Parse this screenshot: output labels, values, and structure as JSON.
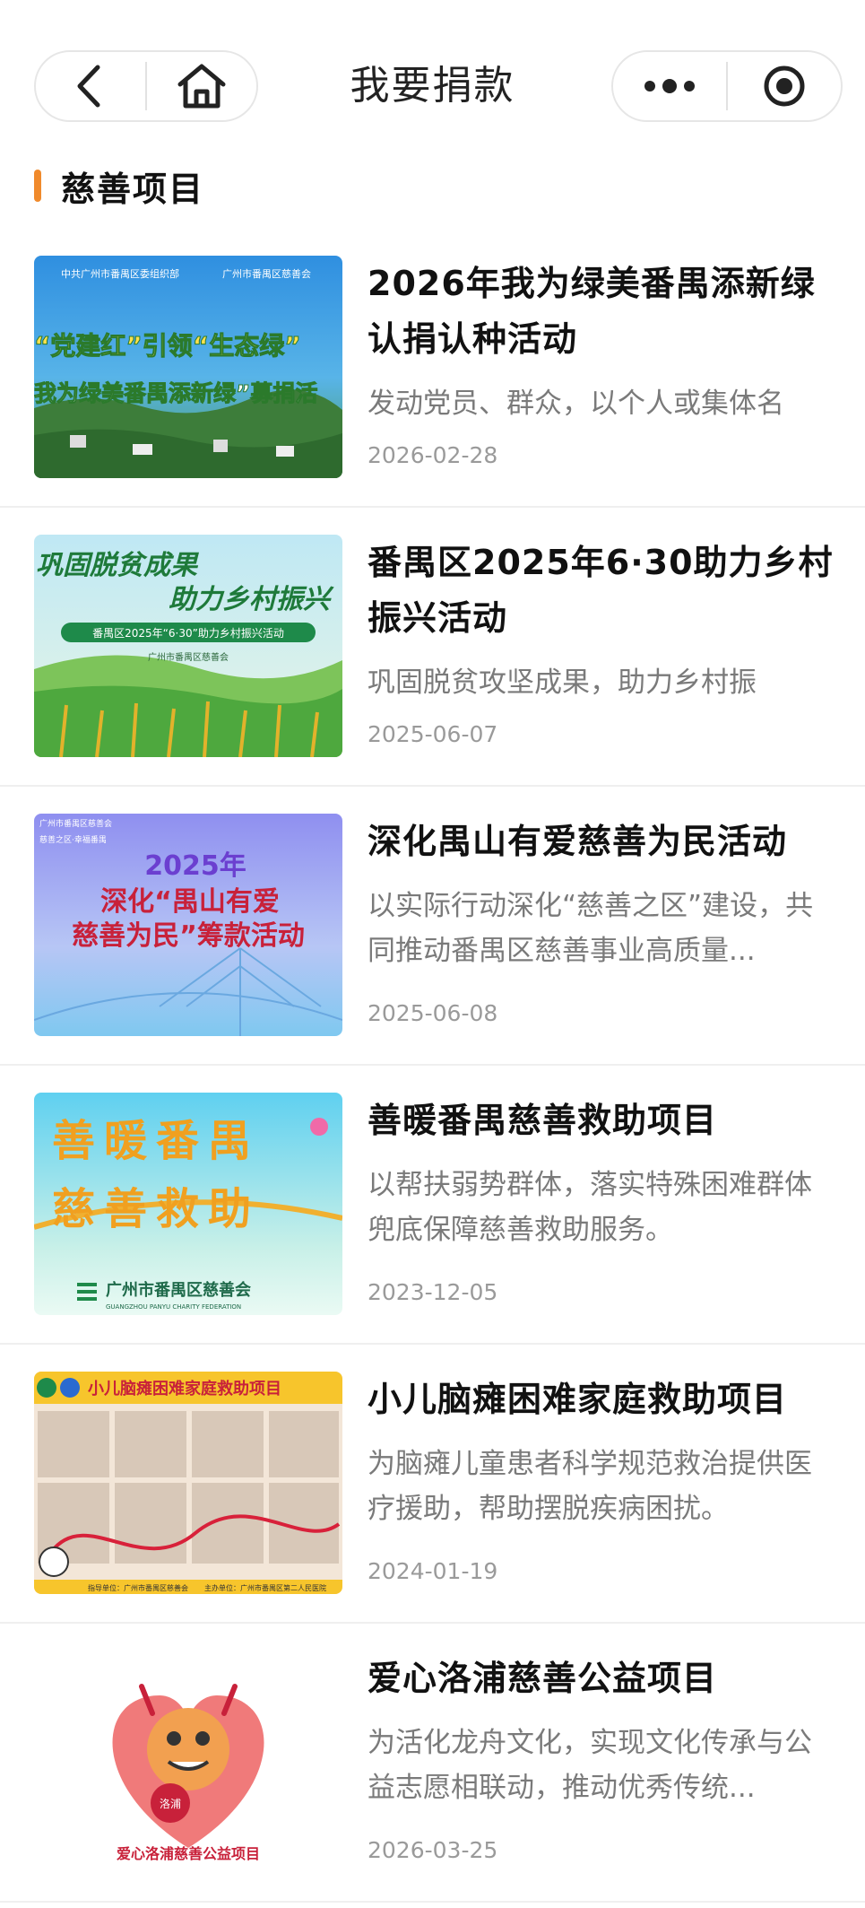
{
  "header": {
    "title": "我要捐款",
    "back_icon": "chevron-left-icon",
    "home_icon": "home-icon",
    "more_icon": "more-dots-icon",
    "record_icon": "target-circle-icon"
  },
  "section": {
    "title": "慈善项目",
    "accent_color": "#f08a2c"
  },
  "items": [
    {
      "title": "2026年我为绿美番禺添新绿认捐认种活动",
      "desc": "发动党员、群众，以个人或集体名",
      "date": "2026-02-28",
      "thumb": {
        "l1": "中共广州市番禺区委组织部",
        "l2": "广州市番禺区慈善会",
        "l3": "“党建红”引领“生态绿”",
        "l4": "我为绿美番禺添新绿”募捐活"
      }
    },
    {
      "title": "番禺区2025年6·30助力乡村振兴活动",
      "desc": "巩固脱贫攻坚成果，助力乡村振",
      "date": "2025-06-07",
      "thumb": {
        "l1": "巩固脱贫成果",
        "l2": "助力乡村振兴",
        "l3": "番禺区2025年“6·30”助力乡村振兴活动",
        "l4": "广州市番禺区慈善会"
      }
    },
    {
      "title": "深化禺山有爱慈善为民活动",
      "desc": "以实际行动深化“慈善之区”建设，共同推动番禺区慈善事业高质量...",
      "date": "2025-06-08",
      "thumb": {
        "l1": "广州市番禺区慈善会",
        "l2": "慈善之区·幸福番禺",
        "l3": "2025年",
        "l4": "深化“禺山有爱",
        "l5": "慈善为民”筹款活动"
      }
    },
    {
      "title": "善暖番禺慈善救助项目",
      "desc": "以帮扶弱势群体，落实特殊困难群体兜底保障慈善救助服务。",
      "date": "2023-12-05",
      "thumb": {
        "l1": "善暖番禺",
        "l2": "慈善救助",
        "l3": "广州市番禺区慈善会",
        "l4": "GUANGZHOU PANYU CHARITY FEDERATION"
      }
    },
    {
      "title": "小儿脑瘫困难家庭救助项目",
      "desc": "为脑瘫儿童患者科学规范救治提供医疗援助，帮助摆脱疾病困扰。",
      "date": "2024-01-19",
      "thumb": {
        "l1": "小儿脑瘫困难家庭救助项目",
        "l2": "指导单位：广州市番禺区慈善会",
        "l3": "主办单位：广州市番禺区第二人民医院"
      }
    },
    {
      "title": "爱心洛浦慈善公益项目",
      "desc": "为活化龙舟文化，实现文化传承与公益志愿相联动，推动优秀传统...",
      "date": "2026-03-25",
      "thumb": {
        "l1": "洛浦",
        "l2": "爱心洛浦慈善公益项目"
      }
    }
  ]
}
